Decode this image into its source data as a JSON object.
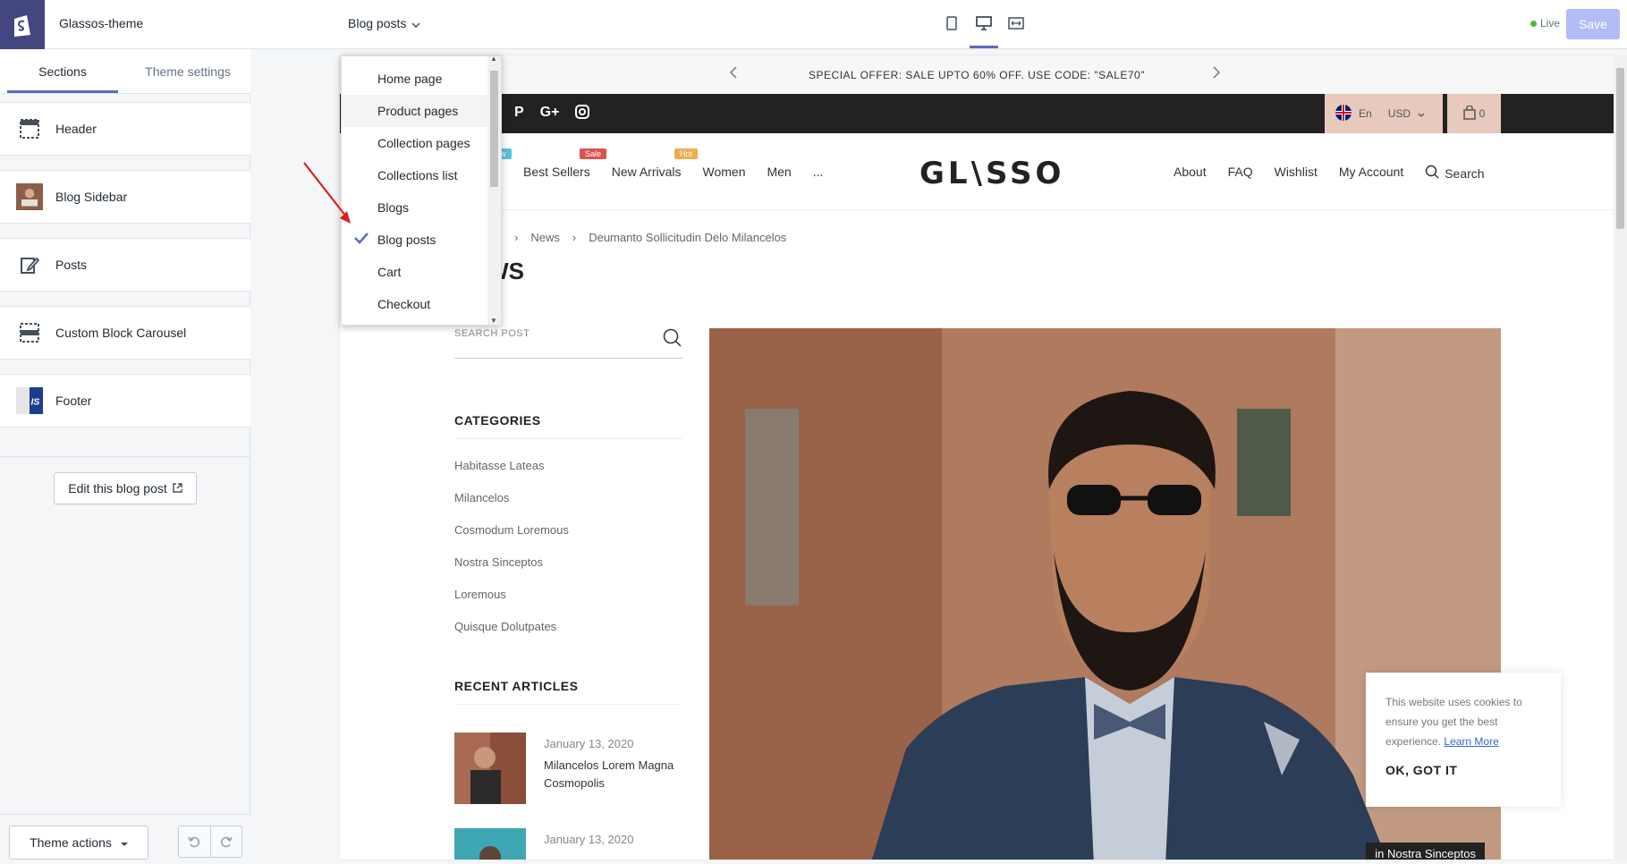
{
  "app": {
    "shop_name": "Glassos-theme"
  },
  "sidebar": {
    "tabs": [
      {
        "label": "Sections"
      },
      {
        "label": "Theme settings"
      }
    ],
    "sections": [
      {
        "label": "Header",
        "icon": "header-layout-icon"
      },
      {
        "label": "Blog Sidebar",
        "icon": "blog-sidebar-thumbnail"
      },
      {
        "label": "Posts",
        "icon": "edit-icon"
      },
      {
        "label": "Custom Block Carousel",
        "icon": "carousel-layout-icon"
      },
      {
        "label": "Footer",
        "icon": "footer-thumbnail"
      }
    ],
    "edit_button": "Edit this blog post",
    "theme_actions": "Theme actions"
  },
  "topbar": {
    "page_selector": "Blog posts",
    "live": "Live",
    "save": "Save"
  },
  "dropdown": {
    "items": [
      "Home page",
      "Product pages",
      "Collection pages",
      "Collections list",
      "Blogs",
      "Blog posts",
      "Cart",
      "Checkout"
    ],
    "selected": "Blog posts"
  },
  "preview": {
    "announcement": "SPECIAL OFFER: SALE UPTO 60% OFF. USE CODE: \"SALE70\"",
    "lang": "En",
    "currency": "USD",
    "cart_count": "0",
    "nav_left": [
      "Best Sellers",
      "New Arrivals",
      "Women",
      "Men",
      "..."
    ],
    "badges": {
      "new": "ew",
      "sale": "Sale",
      "hot": "Hot"
    },
    "brand": "GL\\SSO",
    "nav_right": [
      "About",
      "FAQ",
      "Wishlist",
      "My Account",
      "Search"
    ],
    "breadcrumb": [
      "News",
      "Deumanto Sollicitudin Delo Milancelos"
    ],
    "page_title": "NEWS",
    "search_placeholder": "SEARCH POST",
    "categories_title": "CATEGORIES",
    "categories": [
      "Habitasse Lateas",
      "Milancelos",
      "Cosmodum Loremous",
      "Nostra Sinceptos",
      "Loremous",
      "Quisque Dolutpates"
    ],
    "recent_title": "RECENT ARTICLES",
    "articles": [
      {
        "date": "January 13, 2020",
        "title": "Milancelos Lorem Magna Cosmopolis"
      },
      {
        "date": "January 13, 2020",
        "title": ""
      }
    ],
    "hero_tag": "in Nostra Sinceptos",
    "cookie": {
      "text": "This website uses cookies to ensure you get the best experience.",
      "link": "Learn More",
      "button": "OK, GOT IT"
    }
  },
  "colors": {
    "accent": "#5c6ac4",
    "shopify_logo_bg": "#43467f",
    "save_disabled": "#b3bcf5",
    "sale_badge": "#d9534f",
    "hot_badge": "#f0ad4e",
    "new_badge": "#5bc0de"
  }
}
